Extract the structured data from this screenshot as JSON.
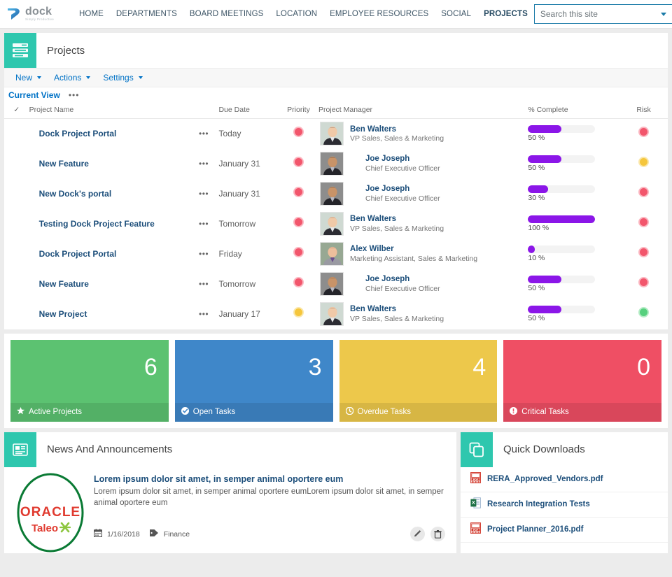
{
  "brand": {
    "logo_word": "dock",
    "logo_sub": "Simply Productive",
    "accent_teal": "#2ec7ae",
    "accent_blue": "#1b7ba8",
    "link_blue": "#0072c6",
    "progress_purple": "#8b16e8"
  },
  "topnav": {
    "items": [
      {
        "label": "HOME",
        "active": false
      },
      {
        "label": "DEPARTMENTS",
        "active": false
      },
      {
        "label": "BOARD MEETINGS",
        "active": false
      },
      {
        "label": "LOCATION",
        "active": false
      },
      {
        "label": "EMPLOYEE RESOURCES",
        "active": false
      },
      {
        "label": "SOCIAL",
        "active": false
      },
      {
        "label": "PROJECTS",
        "active": true
      }
    ],
    "search": {
      "placeholder": "Search this site",
      "value": ""
    }
  },
  "projects_webpart": {
    "title": "Projects",
    "icon": "list-icon",
    "ribbon": [
      {
        "label": "New"
      },
      {
        "label": "Actions"
      },
      {
        "label": "Settings"
      }
    ],
    "view": {
      "label": "Current View",
      "more": "•••"
    },
    "columns": {
      "check": "✓",
      "name": "Project Name",
      "due": "Due Date",
      "priority": "Priority",
      "manager": "Project Manager",
      "percent": "% Complete",
      "risk": "Risk"
    },
    "rows": [
      {
        "name": "Dock Project Portal",
        "due": "Today",
        "priority": "red",
        "manager": "Ben Walters",
        "role": "VP Sales, Sales & Marketing",
        "percent": 50,
        "percent_label": "50 %",
        "risk": "red",
        "avatar": "ben"
      },
      {
        "name": "New Feature",
        "due": "January 31",
        "priority": "red",
        "manager": "Joe Joseph",
        "role": "Chief Executive Officer",
        "percent": 50,
        "percent_label": "50 %",
        "risk": "yellow",
        "avatar": "joe"
      },
      {
        "name": "New Dock's portal",
        "due": "January 31",
        "priority": "red",
        "manager": "Joe Joseph",
        "role": "Chief Executive Officer",
        "percent": 30,
        "percent_label": "30 %",
        "risk": "red",
        "avatar": "joe"
      },
      {
        "name": "Testing Dock Project Feature",
        "due": "Tomorrow",
        "priority": "red",
        "manager": "Ben Walters",
        "role": "VP Sales, Sales & Marketing",
        "percent": 100,
        "percent_label": "100 %",
        "risk": "red",
        "avatar": "ben"
      },
      {
        "name": "Dock Project Portal",
        "due": "Friday",
        "priority": "red",
        "manager": "Alex Wilber",
        "role": "Marketing Assistant, Sales & Marketing",
        "percent": 10,
        "percent_label": "10 %",
        "risk": "red",
        "avatar": "alex"
      },
      {
        "name": "New Feature",
        "due": "Tomorrow",
        "priority": "red",
        "manager": "Joe Joseph",
        "role": "Chief Executive Officer",
        "percent": 50,
        "percent_label": "50 %",
        "risk": "red",
        "avatar": "joe"
      },
      {
        "name": "New Project",
        "due": "January 17",
        "priority": "yellow",
        "manager": "Ben Walters",
        "role": "VP Sales, Sales & Marketing",
        "percent": 50,
        "percent_label": "50 %",
        "risk": "green",
        "avatar": "ben"
      }
    ]
  },
  "tiles": [
    {
      "value": "6",
      "label": "Active Projects",
      "color": "#5cc271",
      "icon": "star-icon"
    },
    {
      "value": "3",
      "label": "Open Tasks",
      "color": "#3f87c9",
      "icon": "check-circle-icon"
    },
    {
      "value": "4",
      "label": "Overdue Tasks",
      "color": "#edc84b",
      "icon": "clock-icon"
    },
    {
      "value": "0",
      "label": "Critical Tasks",
      "color": "#ef4f64",
      "icon": "exclamation-circle-icon"
    }
  ],
  "news": {
    "title": "News And Announcements",
    "icon": "newspaper-icon",
    "item": {
      "headline": "Lorem ipsum dolor sit amet, in semper animal oportere eum",
      "body": "Lorem ipsum dolor sit amet, in semper animal oportere eumLorem ipsum dolor sit amet, in semper animal oportere eum",
      "date": "1/16/2018",
      "tag": "Finance",
      "thumb_line1": "ORACLE",
      "thumb_line2": "Taleo"
    }
  },
  "quick_downloads": {
    "title": "Quick Downloads",
    "icon": "copy-icon",
    "files": [
      {
        "name": "RERA_Approved_Vendors.pdf",
        "type": "pdf"
      },
      {
        "name": "Research Integration Tests",
        "type": "xlsx"
      },
      {
        "name": "Project Planner_2016.pdf",
        "type": "pdf"
      }
    ]
  }
}
